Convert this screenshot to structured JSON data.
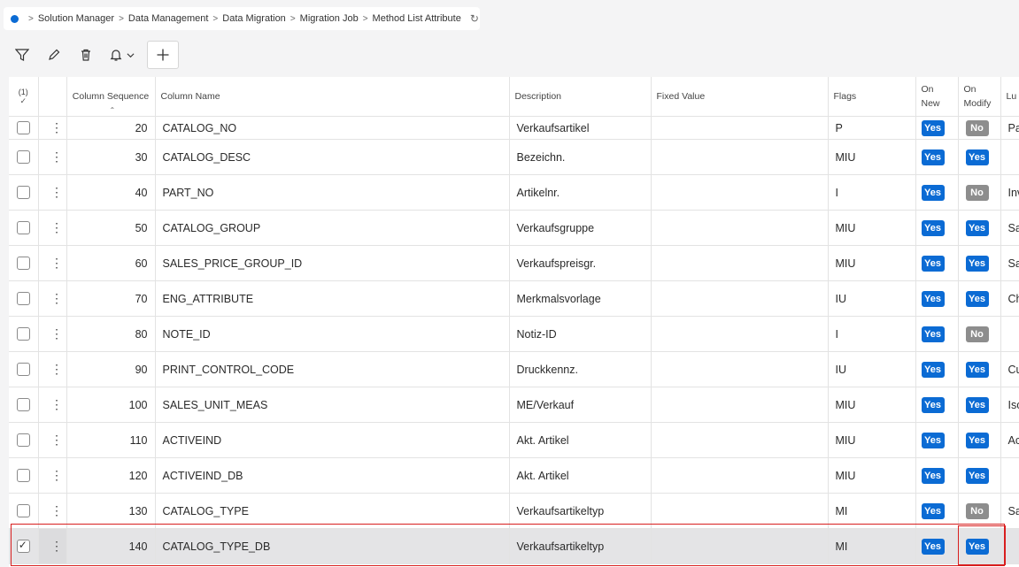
{
  "breadcrumb": {
    "items": [
      "Solution Manager",
      "Data Management",
      "Data Migration",
      "Migration Job",
      "Method List Attribute"
    ]
  },
  "toolbar": {
    "icons": [
      "filter-icon",
      "edit-icon",
      "delete-icon",
      "bell-icon",
      "plus-icon"
    ]
  },
  "table": {
    "selected_count": "(1)",
    "headers": {
      "seq": "Column Sequence",
      "name": "Column Name",
      "desc": "Description",
      "fixed": "Fixed Value",
      "flags": "Flags",
      "on_new_1": "On",
      "on_new_2": "New",
      "on_mod_1": "On",
      "on_mod_2": "Modify",
      "lu": "Lu"
    },
    "rows": [
      {
        "seq": "20",
        "name": "CATALOG_NO",
        "desc": "Verkaufsartikel",
        "fixed": "",
        "flags": "P",
        "on_new": "Yes",
        "on_modify": "No",
        "lu": "Pa",
        "checked": false
      },
      {
        "seq": "30",
        "name": "CATALOG_DESC",
        "desc": "Bezeichn.",
        "fixed": "",
        "flags": "MIU",
        "on_new": "Yes",
        "on_modify": "Yes",
        "lu": "",
        "checked": false
      },
      {
        "seq": "40",
        "name": "PART_NO",
        "desc": "Artikelnr.",
        "fixed": "",
        "flags": "I",
        "on_new": "Yes",
        "on_modify": "No",
        "lu": "Inv",
        "checked": false
      },
      {
        "seq": "50",
        "name": "CATALOG_GROUP",
        "desc": "Verkaufsgruppe",
        "fixed": "",
        "flags": "MIU",
        "on_new": "Yes",
        "on_modify": "Yes",
        "lu": "Sa",
        "checked": false
      },
      {
        "seq": "60",
        "name": "SALES_PRICE_GROUP_ID",
        "desc": "Verkaufspreisgr.",
        "fixed": "",
        "flags": "MIU",
        "on_new": "Yes",
        "on_modify": "Yes",
        "lu": "Sa",
        "checked": false
      },
      {
        "seq": "70",
        "name": "ENG_ATTRIBUTE",
        "desc": "Merkmalsvorlage",
        "fixed": "",
        "flags": "IU",
        "on_new": "Yes",
        "on_modify": "Yes",
        "lu": "Ch",
        "checked": false
      },
      {
        "seq": "80",
        "name": "NOTE_ID",
        "desc": "Notiz-ID",
        "fixed": "",
        "flags": "I",
        "on_new": "Yes",
        "on_modify": "No",
        "lu": "",
        "checked": false
      },
      {
        "seq": "90",
        "name": "PRINT_CONTROL_CODE",
        "desc": "Druckkennz.",
        "fixed": "",
        "flags": "IU",
        "on_new": "Yes",
        "on_modify": "Yes",
        "lu": "Cu",
        "checked": false
      },
      {
        "seq": "100",
        "name": "SALES_UNIT_MEAS",
        "desc": "ME/Verkauf",
        "fixed": "",
        "flags": "MIU",
        "on_new": "Yes",
        "on_modify": "Yes",
        "lu": "Iso",
        "checked": false
      },
      {
        "seq": "110",
        "name": "ACTIVEIND",
        "desc": "Akt. Artikel",
        "fixed": "",
        "flags": "MIU",
        "on_new": "Yes",
        "on_modify": "Yes",
        "lu": "Ac",
        "checked": false
      },
      {
        "seq": "120",
        "name": "ACTIVEIND_DB",
        "desc": "Akt. Artikel",
        "fixed": "",
        "flags": "MIU",
        "on_new": "Yes",
        "on_modify": "Yes",
        "lu": "",
        "checked": false
      },
      {
        "seq": "130",
        "name": "CATALOG_TYPE",
        "desc": "Verkaufsartikeltyp",
        "fixed": "",
        "flags": "MI",
        "on_new": "Yes",
        "on_modify": "No",
        "lu": "Sa",
        "checked": false
      },
      {
        "seq": "140",
        "name": "CATALOG_TYPE_DB",
        "desc": "Verkaufsartikeltyp",
        "fixed": "",
        "flags": "MI",
        "on_new": "Yes",
        "on_modify": "Yes",
        "lu": "",
        "checked": true
      }
    ]
  },
  "colors": {
    "accent": "#0b6bd4",
    "badge_no": "#8d8d8d",
    "highlight": "#d81e1e"
  }
}
